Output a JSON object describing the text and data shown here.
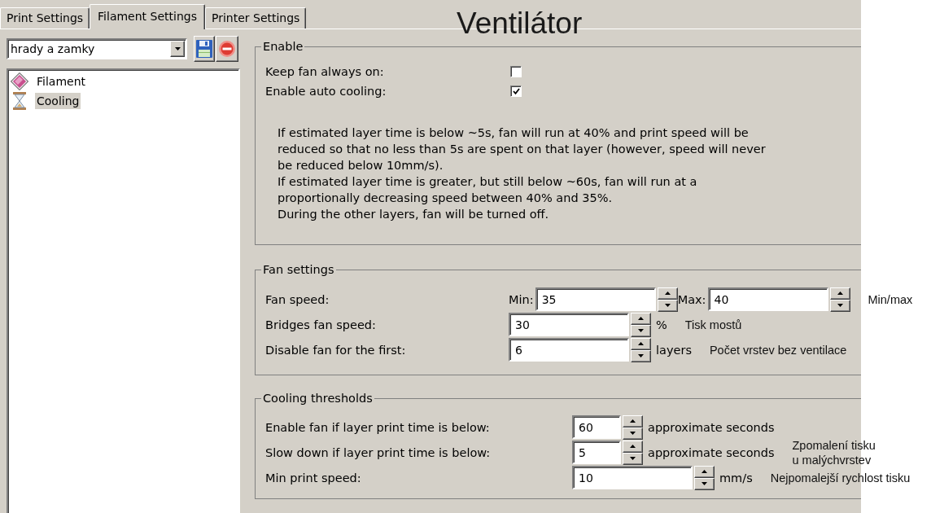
{
  "annotation_title": "Ventilátor",
  "tabs": [
    {
      "label": "Print Settings",
      "selected": false
    },
    {
      "label": "Filament Settings",
      "selected": true
    },
    {
      "label": "Printer Settings",
      "selected": false
    }
  ],
  "preset": {
    "value": "hrady a zamky"
  },
  "tree": [
    {
      "label": "Filament",
      "kind": "filament",
      "selected": false
    },
    {
      "label": "Cooling",
      "kind": "cooling",
      "selected": true
    }
  ],
  "enable": {
    "title": "Enable",
    "options": [
      {
        "label": "Keep fan always on:",
        "checked": false
      },
      {
        "label": "Enable auto cooling:",
        "checked": true
      }
    ],
    "description": "If estimated layer time is below ~5s, fan will run at 40% and print speed will be\nreduced so that no less than 5s are spent on that layer (however, speed will never\nbe reduced below 10mm/s).\nIf estimated layer time is greater, but still below ~60s, fan will run at a\nproportionally decreasing speed between 40% and 35%.\nDuring the other layers, fan will be turned off."
  },
  "fan_settings": {
    "title": "Fan settings",
    "rows": [
      {
        "label": "Fan speed:",
        "fields": [
          {
            "prefix": "Min:",
            "value": "35",
            "kind": "wide"
          },
          {
            "prefix": "Max:",
            "value": "40",
            "kind": "wide"
          }
        ],
        "note": "Min/max"
      },
      {
        "label": "Bridges fan speed:",
        "fields": [
          {
            "value": "30",
            "kind": "wide"
          }
        ],
        "unit": "%",
        "note": "Tisk mostů"
      },
      {
        "label": "Disable fan for the first:",
        "fields": [
          {
            "value": "6",
            "kind": "wide"
          }
        ],
        "unit": "layers",
        "note": "Počet vrstev bez ventilace"
      }
    ]
  },
  "cooling_thresholds": {
    "title": "Cooling thresholds",
    "rows": [
      {
        "label": "Enable fan if layer print time is below:",
        "fields": [
          {
            "value": "60",
            "kind": "narrow"
          }
        ],
        "unit": "approximate seconds"
      },
      {
        "label": "Slow down if layer print time is below:",
        "fields": [
          {
            "value": "5",
            "kind": "narrow"
          }
        ],
        "unit": "approximate seconds",
        "note": "Zpomalení tisku\nu malýchvrstev"
      },
      {
        "label": "Min print speed:",
        "fields": [
          {
            "value": "10",
            "kind": "wide"
          }
        ],
        "unit": "mm/s",
        "note": "Nejpomalejší rychlost tisku"
      }
    ]
  }
}
